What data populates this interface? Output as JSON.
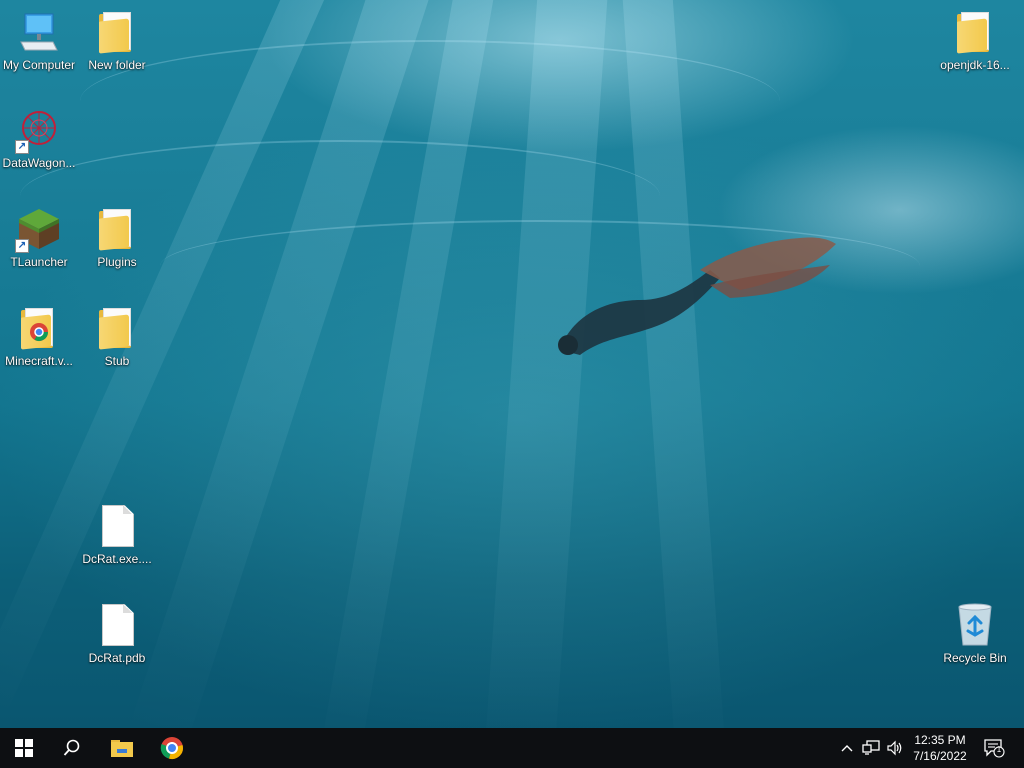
{
  "desktop": {
    "icons": [
      {
        "label": "My Computer"
      },
      {
        "label": "New folder"
      },
      {
        "label": "openjdk-16..."
      },
      {
        "label": "DataWagon..."
      },
      {
        "label": "TLauncher"
      },
      {
        "label": "Plugins"
      },
      {
        "label": "Minecraft.v..."
      },
      {
        "label": "Stub"
      },
      {
        "label": "DcRat.exe...."
      },
      {
        "label": "DcRat.pdb"
      },
      {
        "label": "Recycle Bin"
      }
    ]
  },
  "taskbar": {
    "pinned": [
      "start-icon",
      "search-icon",
      "file-explorer-icon",
      "chrome-icon"
    ],
    "clock": {
      "time": "12:35 PM",
      "date": "7/16/2022"
    },
    "notifications": {
      "count": "1"
    }
  },
  "colors": {
    "taskbar_bg": "#0d0f12",
    "folder_yellow": "#f2c94c",
    "start_blue_white": "#ffffff"
  }
}
